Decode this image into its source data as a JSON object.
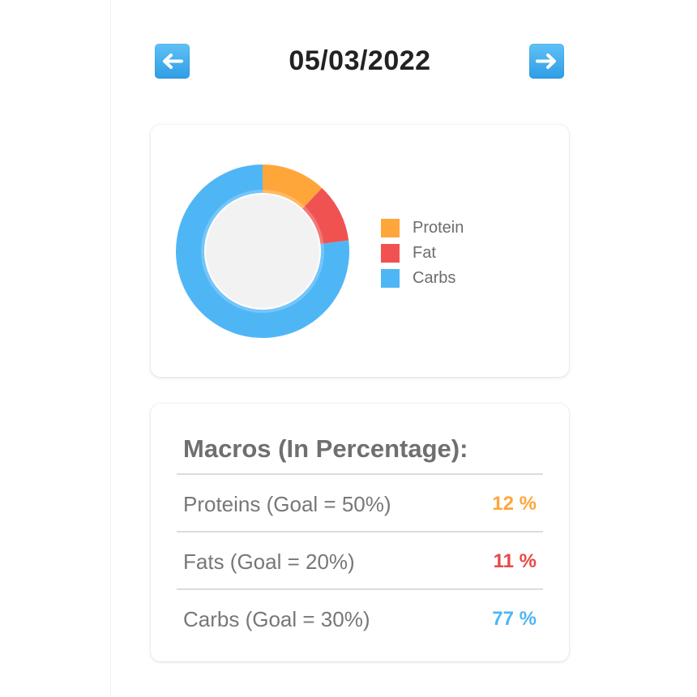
{
  "header": {
    "date": "05/03/2022",
    "prev_icon": "left-arrow-icon",
    "next_icon": "right-arrow-icon"
  },
  "chart_data": {
    "type": "pie",
    "categories": [
      "Protein",
      "Fat",
      "Carbs"
    ],
    "values": [
      12,
      11,
      77
    ],
    "colors": [
      "#ffa63b",
      "#f05252",
      "#4fb6f6"
    ],
    "legend_position": "right",
    "inner_color": "#f2f2f2"
  },
  "macros": {
    "title": "Macros (In Percentage):",
    "rows": [
      {
        "label": "Proteins (Goal = 50%)",
        "value": "12 %",
        "color": "#ffa63b"
      },
      {
        "label": "Fats (Goal = 20%)",
        "value": "11 %",
        "color": "#e94848"
      },
      {
        "label": "Carbs (Goal = 30%)",
        "value": "77 %",
        "color": "#4fb6f6"
      }
    ]
  }
}
